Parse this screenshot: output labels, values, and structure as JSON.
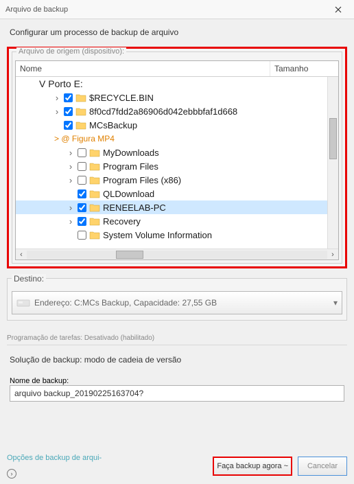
{
  "title": "Arquivo de backup",
  "subtitle": "Configurar um processo de backup de arquivo",
  "source": {
    "legend": "Arquivo de origem (dispositivo):",
    "columns": {
      "name": "Nome",
      "size": "Tamanho"
    },
    "drive": "V Porto E:",
    "figura": "> @ Figura MP4",
    "rows": [
      {
        "label": "$RECYCLE.BIN",
        "checked": true,
        "expand": true
      },
      {
        "label": "8f0cd7fdd2a86906d042ebbbfaf1d668",
        "checked": true,
        "expand": true
      },
      {
        "label": "MCsBackup",
        "checked": true,
        "expand": false
      },
      {
        "label": "MyDownloads",
        "checked": false,
        "expand": true
      },
      {
        "label": "Program Files",
        "checked": false,
        "expand": true
      },
      {
        "label": "Program Files (x86)",
        "checked": false,
        "expand": true
      },
      {
        "label": "QLDownload",
        "checked": true,
        "expand": false
      },
      {
        "label": "RENEELAB-PC",
        "checked": true,
        "expand": true,
        "selected": true
      },
      {
        "label": "Recovery",
        "checked": true,
        "expand": true
      },
      {
        "label": "System Volume Information",
        "checked": false,
        "expand": false
      }
    ]
  },
  "destination": {
    "legend": "Destino:",
    "value": "Endereço: C:MCs Backup, Capacidade: 27,55 GB"
  },
  "schedule": "Programação de tarefas: Desativado (habilitado)",
  "solution_label": "Solução de backup:",
  "solution_value": "modo de cadeia de versão",
  "backup_name_label": "Nome de backup:",
  "backup_name_value": "arquivo backup_20190225163704?",
  "footer": {
    "link": "Opções de backup de arqui-",
    "backup_btn": "Faça backup agora ~",
    "cancel_btn": "Cancelar"
  }
}
